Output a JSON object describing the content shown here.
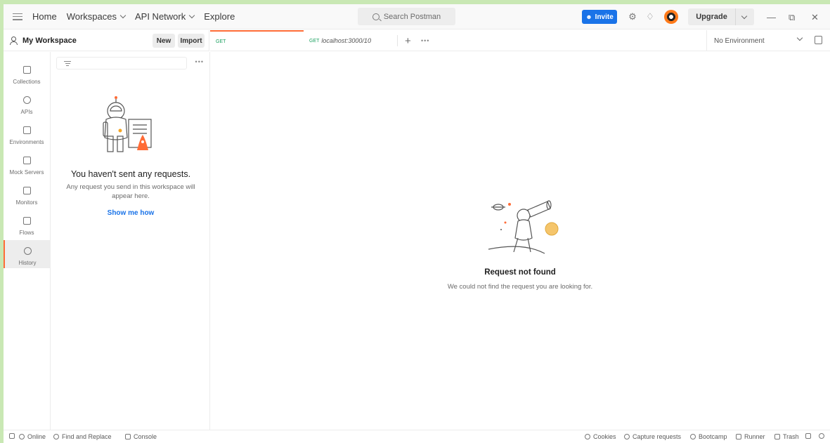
{
  "topbar": {
    "nav": [
      "Home",
      "Workspaces",
      "API Network",
      "Explore"
    ],
    "search_placeholder": "Search Postman",
    "invite_label": "Invite",
    "upgrade_label": "Upgrade"
  },
  "workspace": {
    "title": "My Workspace",
    "new_label": "New",
    "import_label": "Import"
  },
  "tabs": [
    {
      "method": "GET",
      "name": ""
    },
    {
      "method": "GET",
      "name": "localhost:3000/10"
    }
  ],
  "environment": {
    "selected": "No Environment"
  },
  "rail": [
    {
      "label": "Collections",
      "icon": "collections-icon"
    },
    {
      "label": "APIs",
      "icon": "apis-icon"
    },
    {
      "label": "Environments",
      "icon": "environments-icon"
    },
    {
      "label": "Mock Servers",
      "icon": "mock-servers-icon"
    },
    {
      "label": "Monitors",
      "icon": "monitors-icon"
    },
    {
      "label": "Flows",
      "icon": "flows-icon"
    },
    {
      "label": "History",
      "icon": "history-icon"
    }
  ],
  "panel": {
    "empty_title": "You haven't sent any requests.",
    "empty_desc": "Any request you send in this workspace will appear here.",
    "show_link": "Show me how"
  },
  "main": {
    "title": "Request not found",
    "desc": "We could not find the request you are looking for."
  },
  "statusbar": {
    "online": "Online",
    "find_replace": "Find and Replace",
    "console": "Console",
    "cookies": "Cookies",
    "capture": "Capture requests",
    "bootcamp": "Bootcamp",
    "runner": "Runner",
    "trash": "Trash"
  },
  "colors": {
    "accent": "#ff6c37",
    "primary": "#1a73e8",
    "method_get": "#19a05f"
  }
}
